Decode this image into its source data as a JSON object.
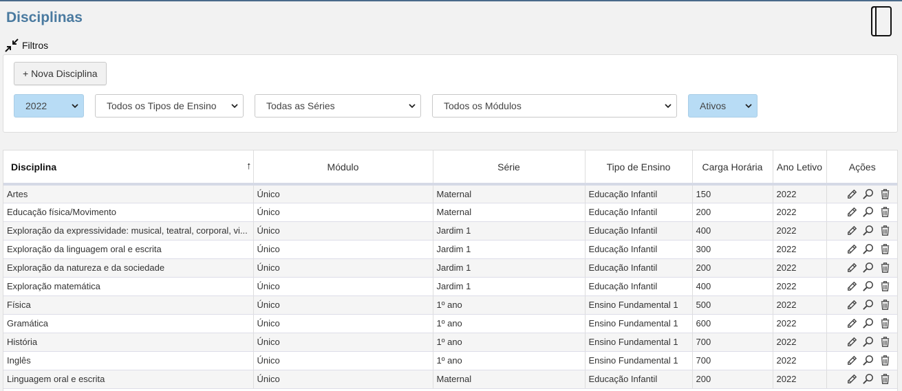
{
  "header": {
    "title": "Disciplinas",
    "book_icon": "book-icon"
  },
  "filters": {
    "toggle_label": "Filtros",
    "new_button": "+ Nova Disciplina",
    "year": "2022",
    "tipo_ensino": "Todos os Tipos de Ensino",
    "serie": "Todas as Séries",
    "modulo": "Todos os Módulos",
    "status": "Ativos",
    "highlight_color": "#b8dcf5"
  },
  "table": {
    "columns": [
      "Disciplina",
      "Módulo",
      "Série",
      "Tipo de Ensino",
      "Carga Horária",
      "Ano Letivo",
      "Ações"
    ],
    "rows": [
      [
        "Artes",
        "Único",
        "Maternal",
        "Educação Infantil",
        "150",
        "2022"
      ],
      [
        "Educação física/Movimento",
        "Único",
        "Maternal",
        "Educação Infantil",
        "200",
        "2022"
      ],
      [
        "Exploração da expressividade: musical, teatral, corporal, vi...",
        "Único",
        "Jardim 1",
        "Educação Infantil",
        "400",
        "2022"
      ],
      [
        "Exploração da linguagem oral e escrita",
        "Único",
        "Jardim 1",
        "Educação Infantil",
        "300",
        "2022"
      ],
      [
        "Exploração da natureza e da sociedade",
        "Único",
        "Jardim 1",
        "Educação Infantil",
        "200",
        "2022"
      ],
      [
        "Exploração matemática",
        "Único",
        "Jardim 1",
        "Educação Infantil",
        "400",
        "2022"
      ],
      [
        "Física",
        "Único",
        "1º ano",
        "Ensino Fundamental 1",
        "500",
        "2022"
      ],
      [
        "Gramática",
        "Único",
        "1º ano",
        "Ensino Fundamental 1",
        "600",
        "2022"
      ],
      [
        "História",
        "Único",
        "1º ano",
        "Ensino Fundamental 1",
        "700",
        "2022"
      ],
      [
        "Inglês",
        "Único",
        "1º ano",
        "Ensino Fundamental 1",
        "700",
        "2022"
      ],
      [
        "Linguagem oral e escrita",
        "Único",
        "Maternal",
        "Educação Infantil",
        "200",
        "2022"
      ]
    ],
    "action_icons": [
      "edit-icon",
      "view-icon",
      "delete-icon"
    ]
  }
}
